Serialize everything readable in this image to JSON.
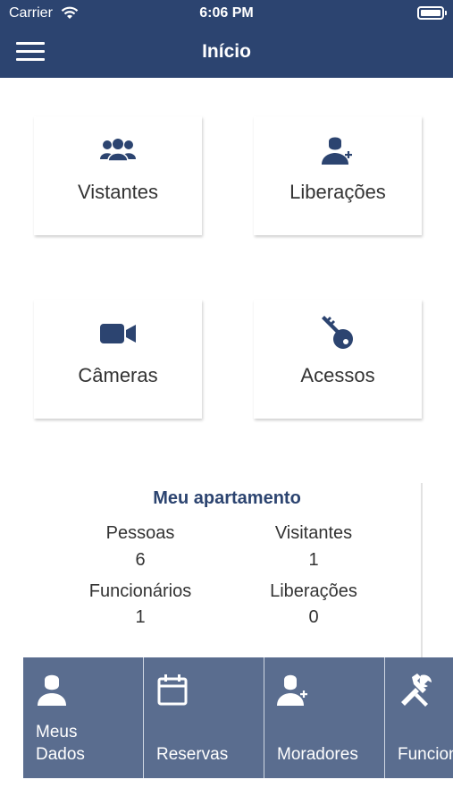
{
  "status_bar": {
    "carrier": "Carrier",
    "time": "6:06 PM"
  },
  "header": {
    "title": "Início"
  },
  "tiles": [
    {
      "label": "Vistantes",
      "icon": "group-icon"
    },
    {
      "label": "Liberações",
      "icon": "user-plus-icon"
    },
    {
      "label": "Câmeras",
      "icon": "video-camera-icon"
    },
    {
      "label": "Acessos",
      "icon": "key-icon"
    }
  ],
  "apartment": {
    "title": "Meu apartamento",
    "stats": [
      {
        "label": "Pessoas",
        "value": "6"
      },
      {
        "label": "Visitantes",
        "value": "1"
      },
      {
        "label": "Funcionários",
        "value": "1"
      },
      {
        "label": "Liberações",
        "value": "0"
      }
    ]
  },
  "tabbar": {
    "items": [
      {
        "label": "Meus\nDados",
        "icon": "user-icon"
      },
      {
        "label": "Reservas",
        "icon": "calendar-icon"
      },
      {
        "label": "Moradores",
        "icon": "user-plus-icon"
      },
      {
        "label": "Funcionários",
        "icon": "tools-icon"
      }
    ]
  },
  "colors": {
    "primary": "#2c4470",
    "tabbar": "#5a6d8f",
    "background": "#ffffff"
  }
}
